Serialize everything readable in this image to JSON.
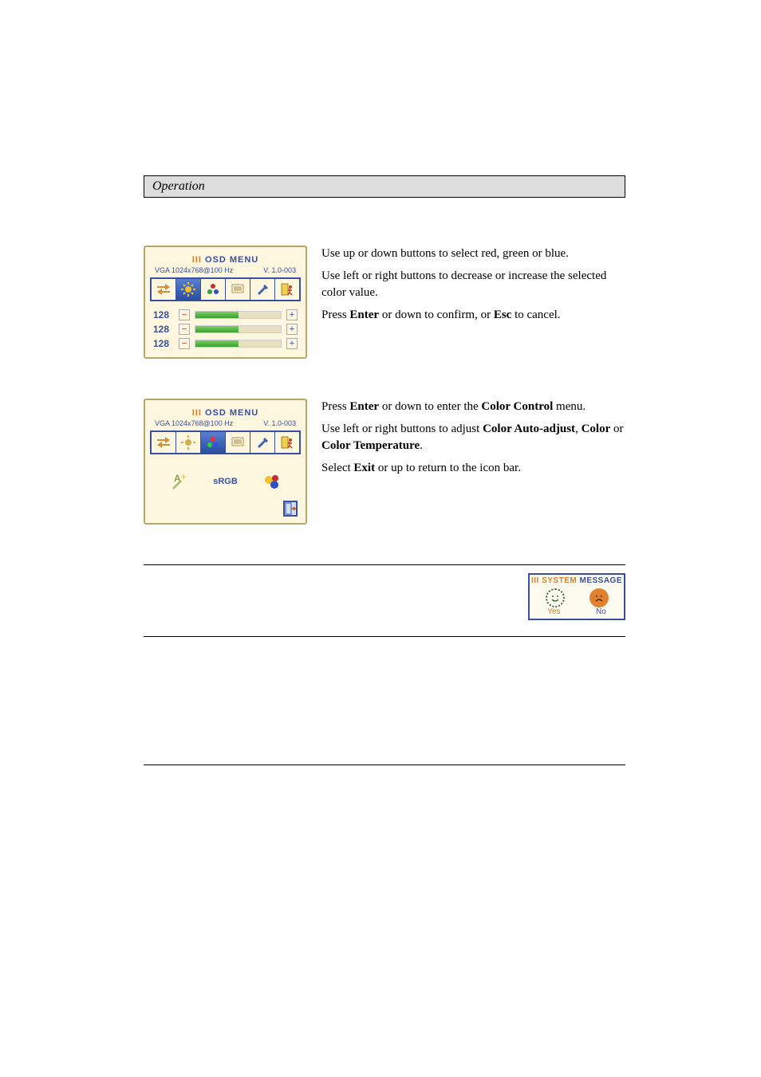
{
  "header": {
    "title": "Operation"
  },
  "osd_common": {
    "title_prefix": "III",
    "title": "OSD MENU",
    "mode_line": "VGA  1024x768@100 Hz",
    "version": "V. 1.0-003"
  },
  "panel1": {
    "sliders": [
      {
        "value": "128"
      },
      {
        "value": "128"
      },
      {
        "value": "128"
      }
    ],
    "text": [
      {
        "pre": "Use up or down buttons to select red, green or blue."
      },
      {
        "pre": "Use left or right buttons to decrease or increase the selected color value."
      },
      {
        "pre": "Press ",
        "b1": "Enter",
        "mid": " or down to confirm, or ",
        "b2": "Esc",
        "post": " to cancel."
      }
    ]
  },
  "panel2": {
    "srgb_label": "sRGB",
    "text": [
      {
        "pre": "Press ",
        "b1": "Enter",
        "mid": " or down to enter the ",
        "b2": "Color Control",
        "post": " menu."
      },
      {
        "pre": "Use left or right buttons to adjust ",
        "b1": "Color Auto-adjust",
        "mid1": ", ",
        "b2": "Color",
        "mid2": " or ",
        "b3": "Color Temperature",
        "post": "."
      },
      {
        "pre": "Select ",
        "b1": "Exit",
        "post": " or up to return to the icon bar."
      }
    ]
  },
  "system_message": {
    "title_prefix": "III",
    "title_a": "SYSTEM",
    "title_b": "MESSAGE",
    "yes": "Yes",
    "no": "No"
  }
}
